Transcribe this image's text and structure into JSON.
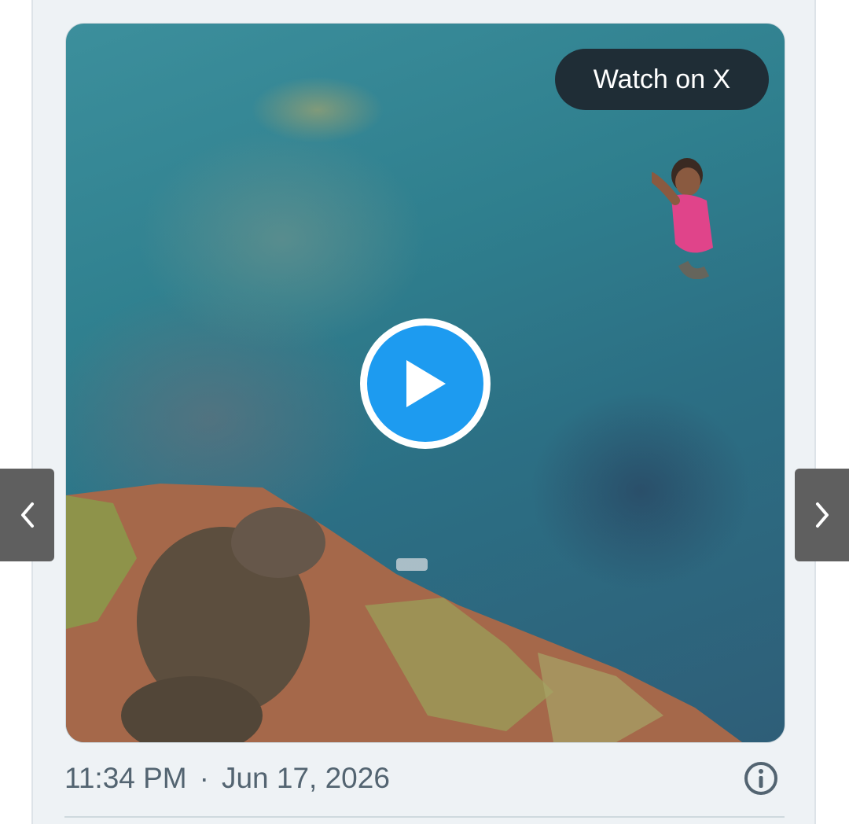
{
  "embed": {
    "watch_label": "Watch on X",
    "time": "11:34 PM",
    "separator": "·",
    "date": "Jun 17, 2026"
  },
  "icons": {
    "play": "play-icon",
    "prev": "chevron-left-icon",
    "next": "chevron-right-icon",
    "info": "info-icon"
  },
  "colors": {
    "play_accent": "#1d9bf0",
    "watch_button_bg": "#1f2d36",
    "timestamp_text": "#536471",
    "card_bg": "#eef2f5",
    "nav_button_bg": "#5f5f5f"
  }
}
